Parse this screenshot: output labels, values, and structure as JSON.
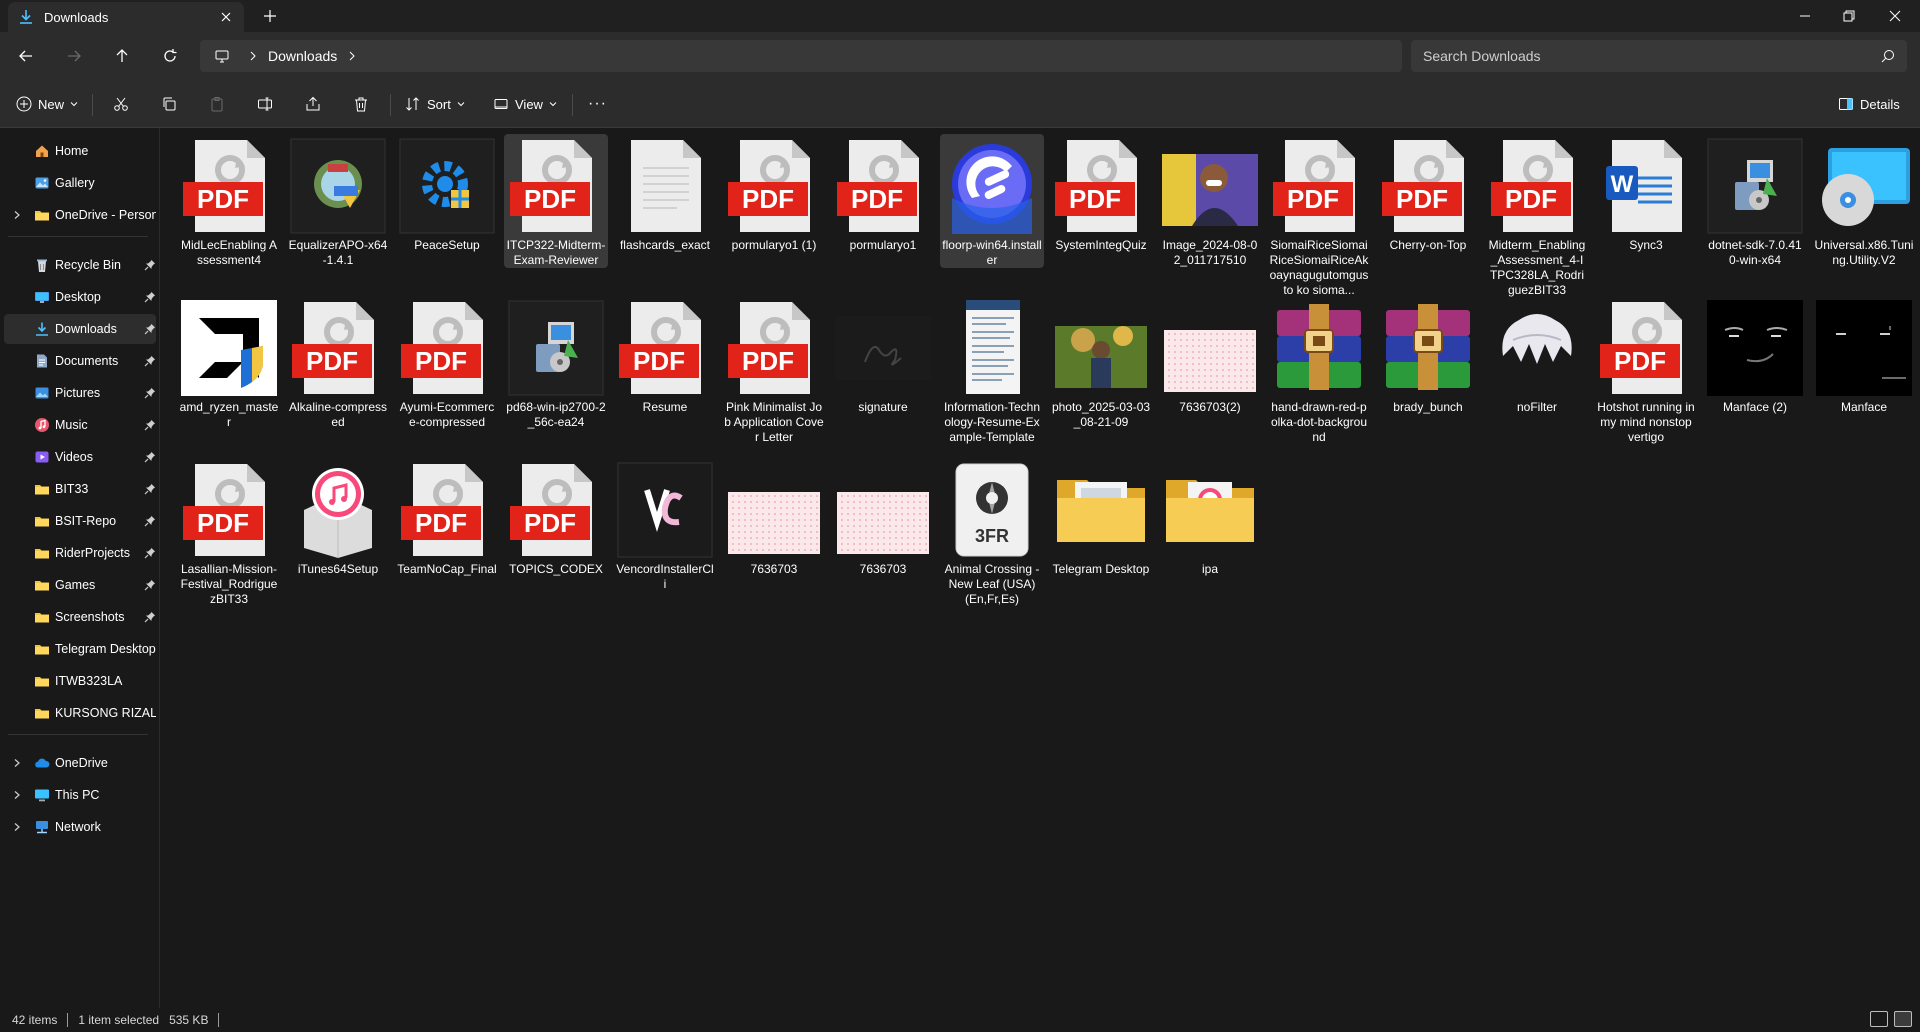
{
  "window": {
    "tab_title": "Downloads",
    "minimize": "—",
    "maximize": "❐",
    "close": "✕"
  },
  "address": {
    "breadcrumb": [
      "Downloads"
    ],
    "search_placeholder": "Search Downloads"
  },
  "toolbar": {
    "new_label": "New",
    "sort_label": "Sort",
    "view_label": "View",
    "more_label": "···",
    "details_label": "Details"
  },
  "sidebar": {
    "top": [
      {
        "label": "Home",
        "icon": "home-icon",
        "expand": false
      },
      {
        "label": "Gallery",
        "icon": "gallery-icon",
        "expand": false
      },
      {
        "label": "OneDrive - Persona",
        "icon": "folder-icon",
        "expand": true
      }
    ],
    "pinned": [
      {
        "label": "Recycle Bin",
        "icon": "recycle-bin-icon",
        "pinned": true
      },
      {
        "label": "Desktop",
        "icon": "desktop-icon",
        "pinned": true
      },
      {
        "label": "Downloads",
        "icon": "download-icon",
        "pinned": true,
        "selected": true
      },
      {
        "label": "Documents",
        "icon": "documents-icon",
        "pinned": true
      },
      {
        "label": "Pictures",
        "icon": "pictures-icon",
        "pinned": true
      },
      {
        "label": "Music",
        "icon": "music-icon",
        "pinned": true
      },
      {
        "label": "Videos",
        "icon": "videos-icon",
        "pinned": true
      },
      {
        "label": "BIT33",
        "icon": "folder-icon",
        "pinned": true
      },
      {
        "label": "BSIT-Repo",
        "icon": "folder-icon",
        "pinned": true
      },
      {
        "label": "RiderProjects",
        "icon": "folder-icon",
        "pinned": true
      },
      {
        "label": "Games",
        "icon": "folder-icon",
        "pinned": true
      },
      {
        "label": "Screenshots",
        "icon": "folder-icon",
        "pinned": true
      },
      {
        "label": "Telegram Desktop",
        "icon": "folder-icon",
        "pinned": false
      },
      {
        "label": "ITWB323LA",
        "icon": "folder-icon",
        "pinned": false
      },
      {
        "label": "KURSONG RIZAL",
        "icon": "folder-icon",
        "pinned": false
      }
    ],
    "bottom": [
      {
        "label": "OneDrive",
        "icon": "onedrive-icon",
        "expand": true
      },
      {
        "label": "This PC",
        "icon": "this-pc-icon",
        "expand": true
      },
      {
        "label": "Network",
        "icon": "network-icon",
        "expand": true
      }
    ]
  },
  "files": [
    {
      "name": "MidLecEnabling Assessment4",
      "kind": "pdf"
    },
    {
      "name": "EqualizerAPO-x64-1.4.1",
      "kind": "installer-equalizer"
    },
    {
      "name": "PeaceSetup",
      "kind": "installer-gear"
    },
    {
      "name": "ITCP322-Midterm-Exam-Reviewer",
      "kind": "pdf",
      "selected": true
    },
    {
      "name": "flashcards_exact",
      "kind": "document"
    },
    {
      "name": "pormularyo1 (1)",
      "kind": "pdf"
    },
    {
      "name": "pormularyo1",
      "kind": "pdf"
    },
    {
      "name": "floorp-win64.installer",
      "kind": "floorp",
      "highlight": true
    },
    {
      "name": "SystemIntegQuiz",
      "kind": "pdf"
    },
    {
      "name": "Image_2024-08-02_011717510",
      "kind": "photo-purple"
    },
    {
      "name": "SiomaiRiceSiomaiRiceSiomaiRiceAkoaynagugutomgusto ko sioma...",
      "kind": "pdf"
    },
    {
      "name": "Cherry-on-Top",
      "kind": "pdf"
    },
    {
      "name": "Midterm_Enabling_Assessment_4-ITPC328LA_RodriguezBIT33",
      "kind": "pdf"
    },
    {
      "name": "Sync3",
      "kind": "word"
    },
    {
      "name": "dotnet-sdk-7.0.410-win-x64",
      "kind": "installer-setup"
    },
    {
      "name": "Universal.x86.Tuning.Utility.V2",
      "kind": "installer-disc"
    },
    {
      "name": "amd_ryzen_master",
      "kind": "amd"
    },
    {
      "name": "Alkaline-compressed",
      "kind": "pdf"
    },
    {
      "name": "Ayumi-Ecommerce-compressed",
      "kind": "pdf"
    },
    {
      "name": "pd68-win-ip2700-2_56c-ea24",
      "kind": "installer-setup"
    },
    {
      "name": "Resume",
      "kind": "pdf"
    },
    {
      "name": "Pink Minimalist Job Application Cover Letter",
      "kind": "pdf"
    },
    {
      "name": "signature",
      "kind": "signature"
    },
    {
      "name": "Information-Technology-Resume-Example-Template",
      "kind": "resume-thumb"
    },
    {
      "name": "photo_2025-03-03_08-21-09",
      "kind": "photo-green"
    },
    {
      "name": "7636703(2)",
      "kind": "polka"
    },
    {
      "name": "hand-drawn-red-polka-dot-background",
      "kind": "winrar"
    },
    {
      "name": "brady_bunch",
      "kind": "winrar"
    },
    {
      "name": "noFilter",
      "kind": "white-hair"
    },
    {
      "name": "Hotshot running in my mind nonstop vertigo",
      "kind": "pdf"
    },
    {
      "name": "Manface (2)",
      "kind": "manface"
    },
    {
      "name": "Manface",
      "kind": "manface-dark"
    },
    {
      "name": "Lasallian-Mission-Festival_RodriguezBIT33",
      "kind": "pdf"
    },
    {
      "name": "iTunes64Setup",
      "kind": "itunes"
    },
    {
      "name": "TeamNoCap_Final",
      "kind": "pdf"
    },
    {
      "name": "TOPICS_CODEX",
      "kind": "pdf"
    },
    {
      "name": "VencordInstallerCli",
      "kind": "vencord"
    },
    {
      "name": "7636703",
      "kind": "polka"
    },
    {
      "name": "7636703",
      "kind": "polka"
    },
    {
      "name": "Animal Crossing - New Leaf (USA) (En,Fr,Es)",
      "kind": "threefr"
    },
    {
      "name": "Telegram Desktop",
      "kind": "folder-photo"
    },
    {
      "name": "ipa",
      "kind": "folder-music"
    }
  ],
  "status": {
    "items_count": "42 items",
    "selection": "1 item selected",
    "size": "535 KB"
  },
  "colors": {
    "background": "#191919",
    "chrome": "#2c2c2c",
    "pdf_red": "#e2231a",
    "folder_yellow": "#f2c641",
    "accent_blue": "#4cc2ff"
  }
}
